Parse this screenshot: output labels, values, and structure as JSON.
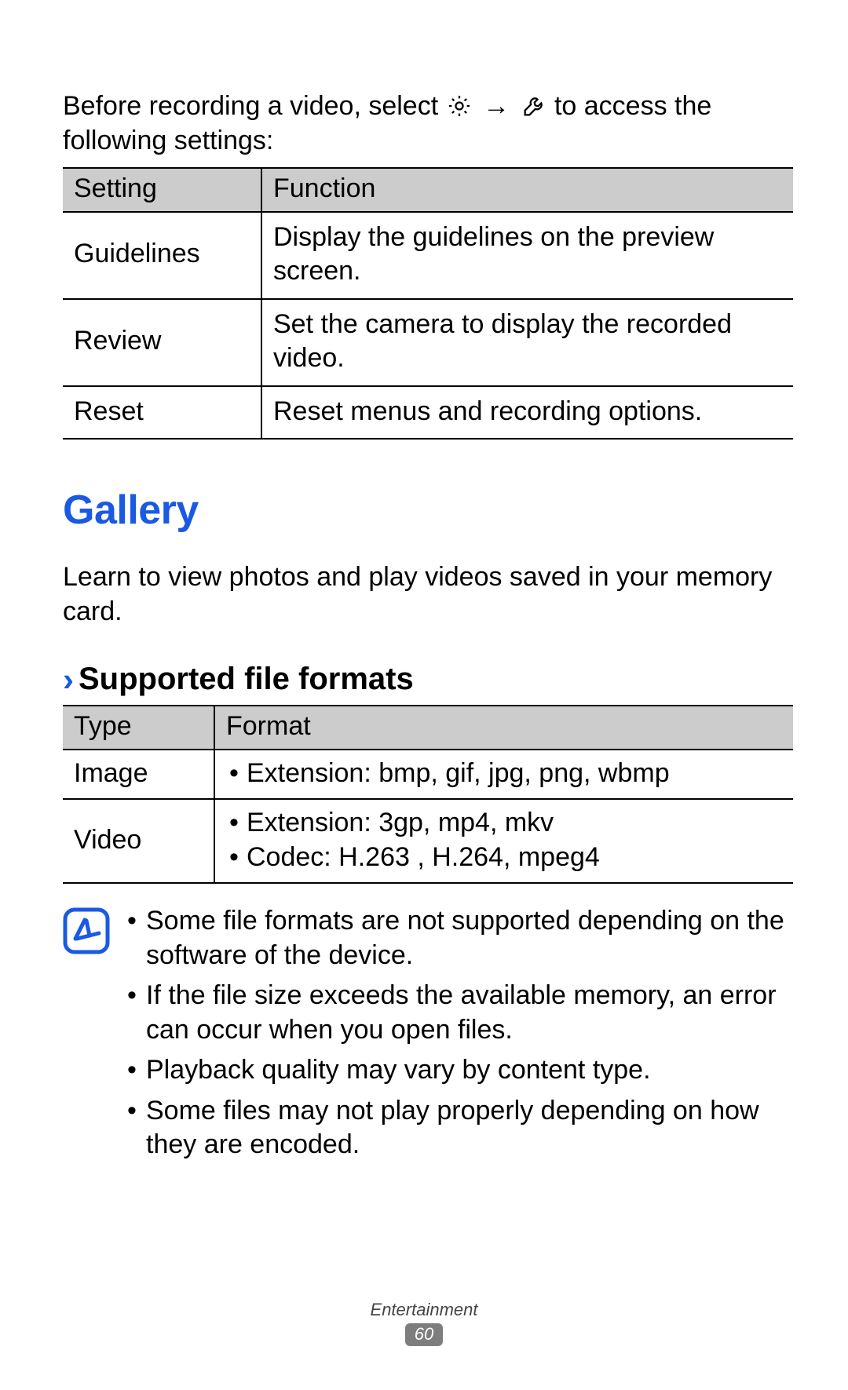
{
  "intro": {
    "part1": "Before recording a video, select ",
    "arrow": "→",
    "part2": " to access the following settings:"
  },
  "settings_table": {
    "headers": {
      "setting": "Setting",
      "function": "Function"
    },
    "rows": [
      {
        "setting": "Guidelines",
        "function": "Display the guidelines on the preview screen."
      },
      {
        "setting": "Review",
        "function": "Set the camera to display the recorded video."
      },
      {
        "setting": "Reset",
        "function": "Reset menus and recording options."
      }
    ]
  },
  "section": {
    "title": "Gallery",
    "lead": "Learn to view photos and play videos saved in your memory card."
  },
  "subsection": {
    "title": "Supported file formats"
  },
  "formats_table": {
    "headers": {
      "type": "Type",
      "format": "Format"
    },
    "rows": [
      {
        "type": "Image",
        "items": [
          "Extension: bmp, gif, jpg, png, wbmp"
        ]
      },
      {
        "type": "Video",
        "items": [
          "Extension: 3gp, mp4, mkv",
          "Codec: H.263 , H.264, mpeg4"
        ]
      }
    ]
  },
  "notes": [
    "Some file formats are not supported depending on the software of the device.",
    "If the file size exceeds the available memory, an error can occur when you open files.",
    "Playback quality may vary by content type.",
    "Some files may not play properly depending on how they are encoded."
  ],
  "footer": {
    "section": "Entertainment",
    "page": "60"
  },
  "icons": {
    "gear_name": "gear-icon",
    "wrench_name": "wrench-icon",
    "note_name": "note-icon"
  }
}
